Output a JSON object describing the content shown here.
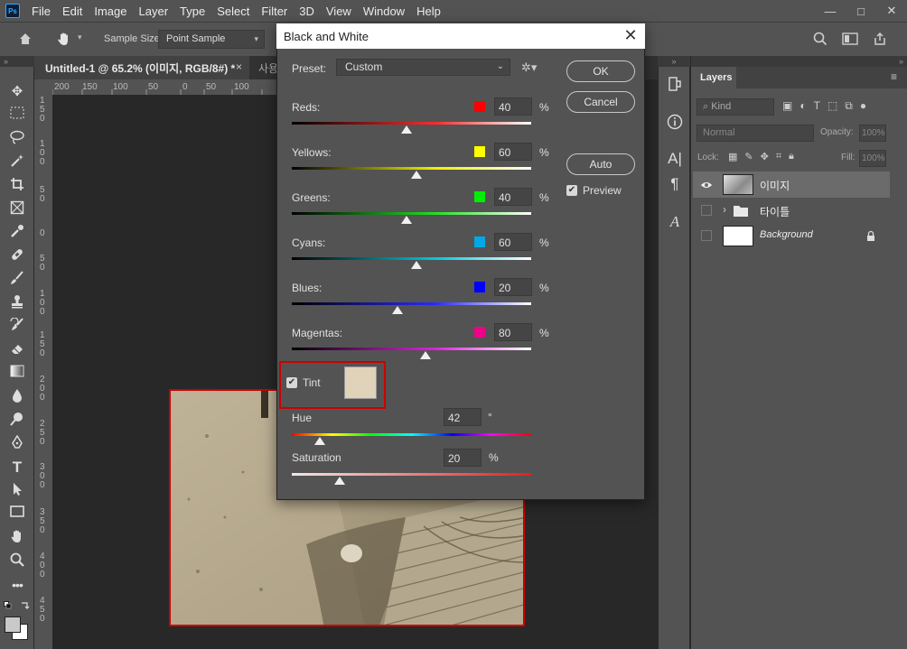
{
  "menu": [
    "File",
    "Edit",
    "Image",
    "Layer",
    "Type",
    "Select",
    "Filter",
    "3D",
    "View",
    "Window",
    "Help"
  ],
  "app_logo": "Ps",
  "window_controls": {
    "minimize": "—",
    "maximize": "□",
    "close": "✕"
  },
  "options": {
    "sample_size_label": "Sample Size:",
    "sample_size_value": "Point Sample"
  },
  "tabs": {
    "active_title": "Untitled-1 @ 65.2% (이미지, RGB/8#) *",
    "close": "×",
    "second_title": "사용"
  },
  "panel_collapse": "»",
  "ruler_top": [
    "200",
    "150",
    "100",
    "50",
    "0",
    "50",
    "100"
  ],
  "ruler_left": [
    "1\n5\n0",
    "1\n0\n0",
    "5\n0",
    "0",
    "5\n0",
    "1\n0\n0",
    "1\n5\n0",
    "2\n0\n0",
    "2\n5\n0",
    "3\n0\n0",
    "3\n5\n0",
    "4\n0\n0",
    "4\n5\n0"
  ],
  "dialog": {
    "title": "Black and White",
    "close": "✕",
    "preset_label": "Preset:",
    "preset_value": "Custom",
    "ok_label": "OK",
    "cancel_label": "Cancel",
    "auto_label": "Auto",
    "preview_label": "Preview",
    "preview_checked": true,
    "sliders": [
      {
        "label": "Reds:",
        "value": "40",
        "unit": "%",
        "swatch": "#ff0000",
        "pct": 0.48
      },
      {
        "label": "Yellows:",
        "value": "60",
        "unit": "%",
        "swatch": "#ffff00",
        "pct": 0.52
      },
      {
        "label": "Greens:",
        "value": "40",
        "unit": "%",
        "swatch": "#00ee00",
        "pct": 0.48
      },
      {
        "label": "Cyans:",
        "value": "60",
        "unit": "%",
        "swatch": "#00a8e8",
        "pct": 0.52
      },
      {
        "label": "Blues:",
        "value": "20",
        "unit": "%",
        "swatch": "#0000ff",
        "pct": 0.44
      },
      {
        "label": "Magentas:",
        "value": "80",
        "unit": "%",
        "swatch": "#ee0088",
        "pct": 0.56
      }
    ],
    "tint": {
      "label": "Tint",
      "checked": true,
      "color": "#e0d3b9",
      "hue_label": "Hue",
      "hue_value": "42",
      "hue_unit": "°",
      "hue_pct": 0.117,
      "sat_label": "Saturation",
      "sat_value": "20",
      "sat_unit": "%",
      "sat_pct": 0.2
    }
  },
  "layers_panel": {
    "tab": "Layers",
    "menu": "≡",
    "kind_placeholder": "Kind",
    "blend_mode": "Normal",
    "opacity_label": "Opacity:",
    "opacity_value": "100%",
    "lock_label": "Lock:",
    "fill_label": "Fill:",
    "fill_value": "100%",
    "layers": [
      {
        "name": "이미지",
        "visible": true,
        "selected": true
      },
      {
        "name": "타이틀",
        "visible": false,
        "selected": false
      },
      {
        "name": "Background",
        "visible": false,
        "selected": false
      }
    ]
  }
}
